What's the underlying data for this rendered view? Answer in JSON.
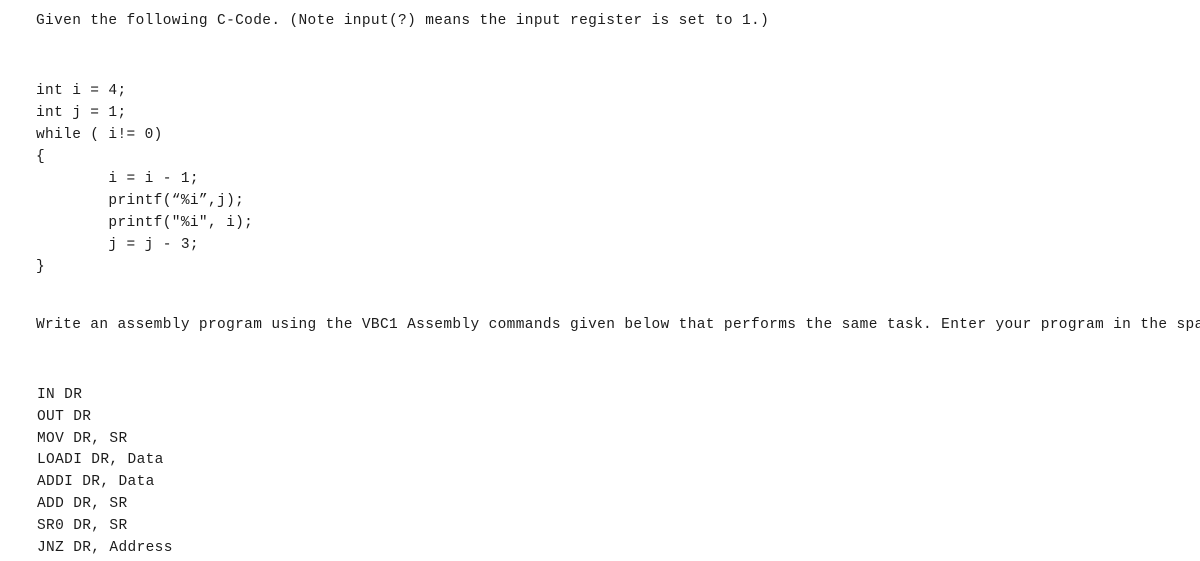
{
  "document": {
    "background_color": "#ffffff",
    "text_color": "#1c1c1c"
  },
  "prompt": {
    "header": "Given the following C-Code. (Note input(?) means the input register is set to 1.)"
  },
  "c_code": {
    "lines": [
      "int i = 4;",
      "int j = 1;",
      "while ( i!= 0)",
      "{",
      "        i = i - 1;",
      "        printf(“%i”,j);",
      "        printf(\"%i\", i);",
      "        j = j - 3;",
      "}"
    ]
  },
  "instruction": {
    "text": "Write an assembly program using the VBC1 Assembly commands given below that performs the same task. Enter your program in the space provided."
  },
  "assembly_commands": {
    "items": [
      "IN DR",
      "OUT DR",
      "MOV DR, SR",
      "LOADI DR, Data",
      "ADDI DR, Data",
      "ADD DR, SR",
      "SR0 DR, SR",
      "JNZ DR, Address"
    ]
  }
}
